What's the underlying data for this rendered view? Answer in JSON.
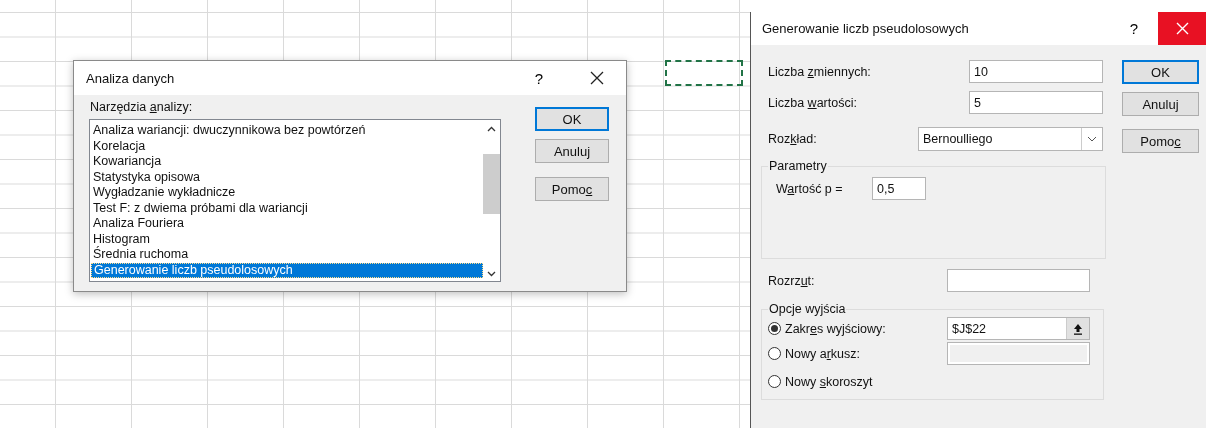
{
  "analysis_dialog": {
    "title": "Analiza danych",
    "help": "?",
    "tools_label": {
      "pre": "Narzędzia ",
      "key": "a",
      "post": "nalizy:"
    },
    "tools": [
      {
        "label": "Analiza wariancji: dwuczynnikowa bez powtórzeń",
        "selected": false
      },
      {
        "label": "Korelacja",
        "selected": false
      },
      {
        "label": "Kowariancja",
        "selected": false
      },
      {
        "label": "Statystyka opisowa",
        "selected": false
      },
      {
        "label": "Wygładzanie wykładnicze",
        "selected": false
      },
      {
        "label": "Test F: z dwiema próbami dla wariancji",
        "selected": false
      },
      {
        "label": "Analiza Fouriera",
        "selected": false
      },
      {
        "label": "Histogram",
        "selected": false
      },
      {
        "label": "Średnia ruchoma",
        "selected": false
      },
      {
        "label": "Generowanie liczb pseudolosowych",
        "selected": true
      }
    ],
    "buttons": [
      {
        "label": {
          "pre": "OK"
        },
        "default": true
      },
      {
        "label": {
          "pre": "Anuluj"
        },
        "default": false
      },
      {
        "label": {
          "pre": "Pomo",
          "key": "c"
        },
        "default": false
      }
    ]
  },
  "generator_dialog": {
    "title": "Generowanie liczb pseudolosowych",
    "help": "?",
    "fields": [
      {
        "label": {
          "pre": "Liczba ",
          "key": "z",
          "post": "miennych:"
        },
        "value": "10"
      },
      {
        "label": {
          "pre": "Liczba ",
          "key": "w",
          "post": "artości:"
        },
        "value": "5"
      }
    ],
    "distribution": {
      "label": {
        "pre": "Roz",
        "key": "k",
        "post": "ład:"
      },
      "value": "Bernoulliego"
    },
    "buttons": [
      {
        "label": {
          "pre": "OK"
        },
        "default": true
      },
      {
        "label": {
          "pre": "Anuluj"
        },
        "default": false
      },
      {
        "label": {
          "pre": "Pomo",
          "key": "c"
        },
        "default": false
      }
    ],
    "parameters": {
      "title": "Parametry",
      "fields": [
        {
          "label": {
            "pre": "W",
            "key": "a",
            "post": "rtość p ="
          },
          "value": "0,5"
        }
      ]
    },
    "spread": {
      "label": {
        "pre": "Rozrz",
        "key": "u",
        "post": "t:"
      }
    },
    "output": {
      "title": "Opcje wyjścia",
      "options": [
        {
          "label": {
            "pre": "Zakr",
            "key": "e",
            "post": "s wyjściowy:"
          },
          "selected": true,
          "kind": "range",
          "value": "$J$22"
        },
        {
          "label": {
            "pre": "Nowy a",
            "key": "r",
            "post": "kusz:"
          },
          "selected": false,
          "kind": "name"
        },
        {
          "label": {
            "pre": "Nowy ",
            "key": "s",
            "post": "koroszyt"
          },
          "selected": false,
          "kind": "plain"
        }
      ]
    }
  }
}
